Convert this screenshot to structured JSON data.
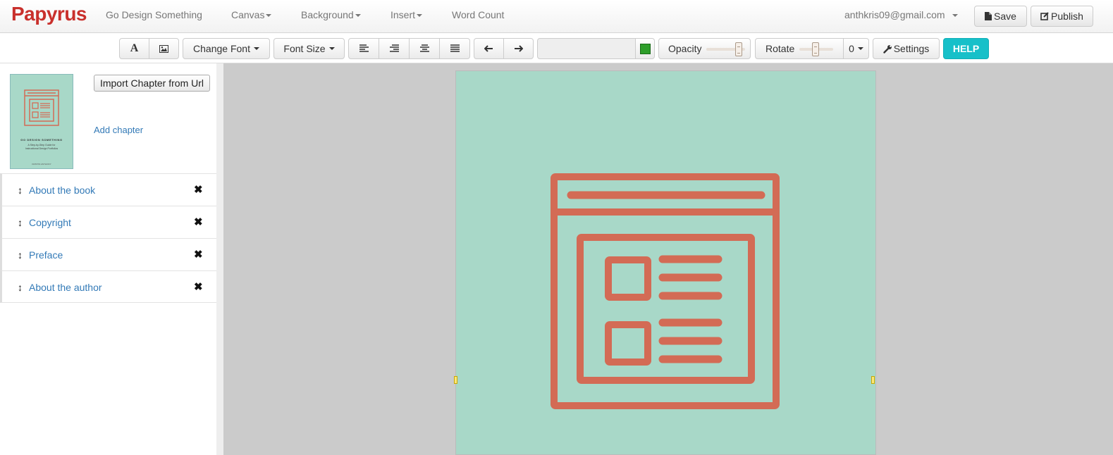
{
  "navbar": {
    "brand": "Papyrus",
    "book_title": "Go Design Something",
    "menus": [
      "Canvas",
      "Background",
      "Insert"
    ],
    "word_count": "Word Count",
    "user_email": "anthkris09@gmail.com",
    "save_label": "Save",
    "publish_label": "Publish"
  },
  "toolbar": {
    "change_font": "Change Font",
    "font_size": "Font Size",
    "color_value": "",
    "color_swatch": "#2e9e2a",
    "opacity_label": "Opacity",
    "opacity_value": 0.9,
    "rotate_label": "Rotate",
    "rotate_value": "0",
    "settings_label": "Settings",
    "help_label": "HELP"
  },
  "sidebar": {
    "import_label": "Import Chapter from Url",
    "add_chapter_label": "Add chapter",
    "chapters": [
      "About the book",
      "Copyright",
      "Preface",
      "About the author"
    ],
    "cover_text": {
      "title": "GO DESIGN SOMETHING",
      "subtitle_1": "A Step-by-Step Guide for",
      "subtitle_2": "Instructional Design Portfolios",
      "author": "KRISTIN ANTHONY"
    }
  },
  "colors": {
    "brand": "#c9302c",
    "page_background": "#a8d8c8",
    "illustration": "#d36b55",
    "link": "#337ab7",
    "help_button": "#17c0c9"
  }
}
